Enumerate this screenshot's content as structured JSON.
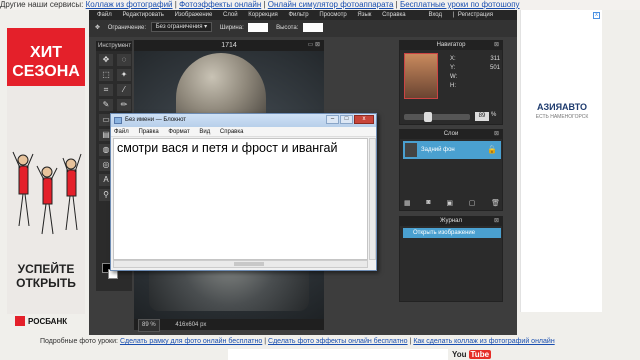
{
  "topbar": {
    "prefix": "Другие наши сервисы:",
    "links": [
      "Коллаж из фотографий",
      "Фотоэффекты онлайн",
      "Онлайн симулятор фотоаппарата",
      "Бесплатные уроки по фотошопу"
    ],
    "separator": "|"
  },
  "left_ad": {
    "headline_1": "ХИТ",
    "headline_2": "СЕЗОНА",
    "cta_1": "УСПЕЙТЕ",
    "cta_2": "ОТКРЫТЬ",
    "bank": "РОСБАНК",
    "colors": {
      "red": "#e4202a"
    }
  },
  "right_ad": {
    "brand": "АЗИЯАВТО",
    "tagline": "ЕСТЬ НАМЕНОГОРСК",
    "close": "x"
  },
  "editor": {
    "menu": [
      "Файл",
      "Редактировать",
      "Изображение",
      "Слой",
      "Коррекция",
      "Фильтр",
      "Просмотр",
      "Язык",
      "Справка"
    ],
    "login": "Вход",
    "register": "Регистрация",
    "options": {
      "restriction_label": "Ограничение:",
      "restriction_value": "Без ограничения",
      "width_label": "Ширина:",
      "height_label": "Высота:"
    },
    "tools_title": "Инструмент",
    "tools": [
      "move-icon",
      "lasso-icon",
      "marquee-icon",
      "wand-icon",
      "crop-icon",
      "eyedropper-icon",
      "brush-icon",
      "pencil-icon",
      "eraser-icon",
      "fill-icon",
      "gradient-icon",
      "clone-icon",
      "blur-icon",
      "sharpen-icon",
      "sponge-icon",
      "dodge-icon",
      "text-icon",
      "hand-icon",
      "zoom-icon",
      "shape-icon"
    ],
    "canvas": {
      "title": "1714",
      "zoom": "89",
      "zoom_unit": "%",
      "size": "416x604 px"
    },
    "navigator": {
      "title": "Навигатор",
      "x_label": "X:",
      "x_value": "311",
      "y_label": "Y:",
      "y_value": "501",
      "w_label": "W:",
      "w_value": "",
      "h_label": "H:",
      "h_value": "",
      "zoom": "89",
      "zoom_unit": "%"
    },
    "layers": {
      "title": "Слои",
      "items": [
        {
          "name": "Задний фон"
        }
      ]
    },
    "journal": {
      "title": "Журнал",
      "items": [
        {
          "name": "Открыть изображение"
        }
      ]
    }
  },
  "notepad": {
    "title": "Без имени — Блокнот",
    "menu": [
      "Файл",
      "Правка",
      "Формат",
      "Вид",
      "Справка"
    ],
    "content": "смотри вася и петя и фрост и ивангай",
    "buttons": {
      "minimize": "–",
      "maximize": "□",
      "close": "x"
    }
  },
  "bottom": {
    "prefix": "Подробные фото уроки:",
    "links": [
      "Сделать рамку для фото онлайн бесплатно",
      "Сделать фото эффекты онлайн бесплатно",
      "Как сделать коллаж из фотографий онлайн"
    ],
    "separator": "|",
    "youtube": "You",
    "youtube_tube": "Tube"
  }
}
